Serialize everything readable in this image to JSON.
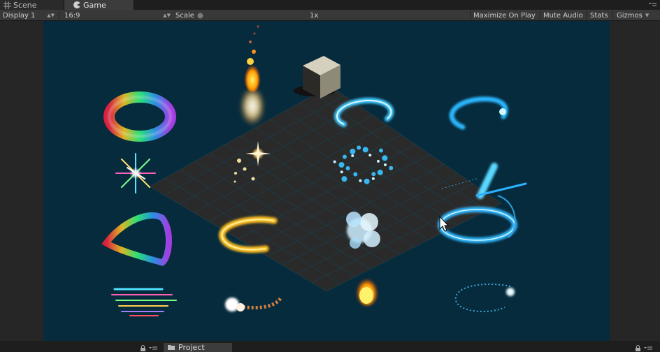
{
  "tabs": {
    "scene_label": "Scene",
    "game_label": "Game"
  },
  "toolbar": {
    "display": "Display 1",
    "aspect": "16:9",
    "scale_label": "Scale",
    "scale_value": "1x",
    "maximize_label": "Maximize On Play",
    "mute_label": "Mute Audio",
    "stats_label": "Stats",
    "gizmos_label": "Gizmos"
  },
  "bottom": {
    "project_label": "Project"
  },
  "colors": {
    "background": "#062b3d",
    "grid_floor": "#2a2a2a",
    "grid_line": "#1b2f36"
  },
  "icons": [
    "scene-grid-icon",
    "game-pacman-icon",
    "dropdown-arrow-icon",
    "tab-menu-icon",
    "folder-icon",
    "lock-icon",
    "mouse-cursor-icon"
  ]
}
